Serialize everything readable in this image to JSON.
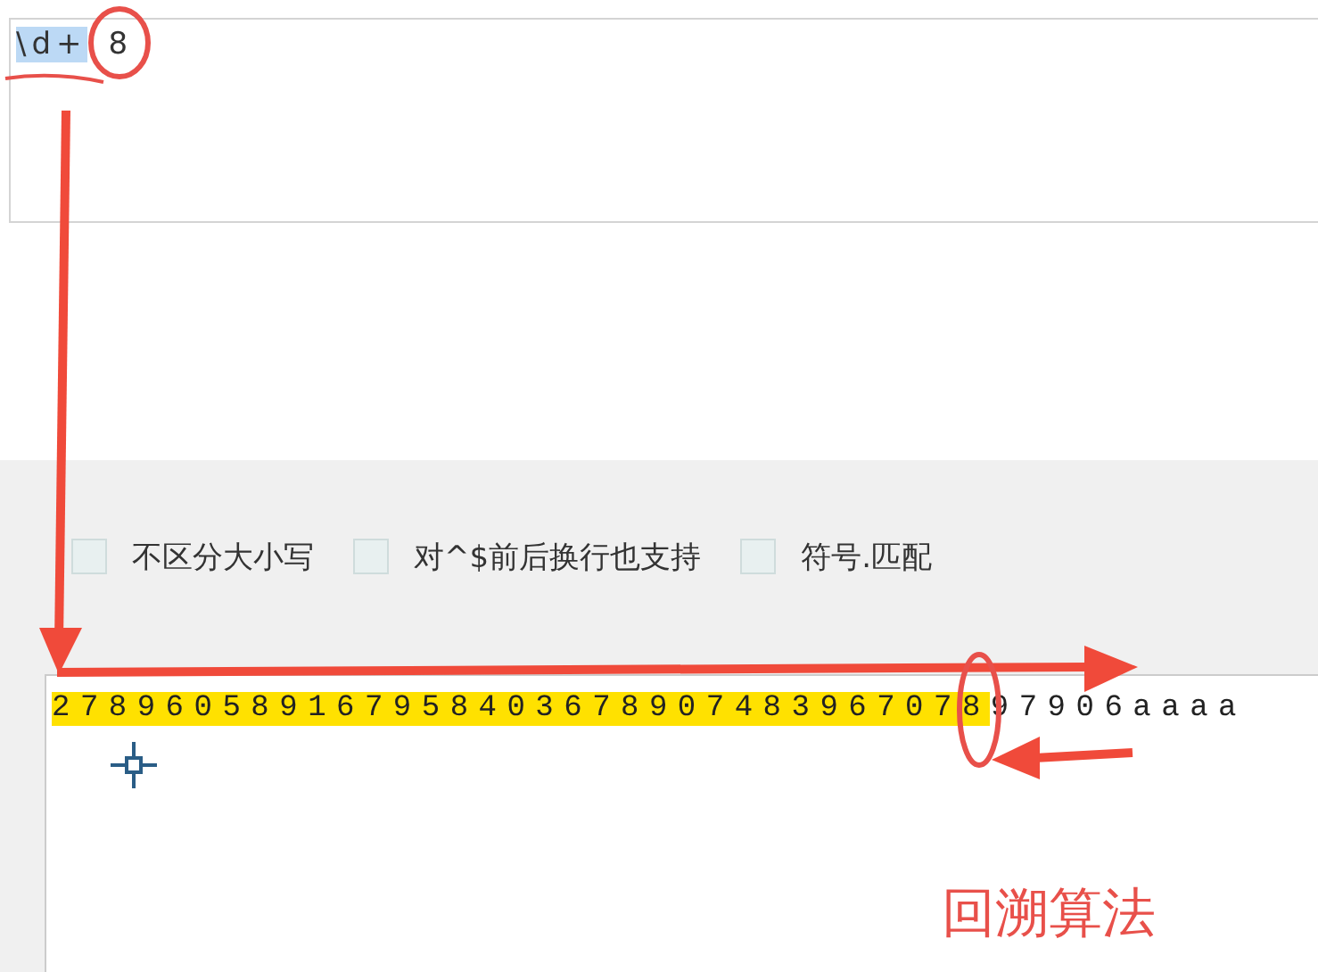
{
  "pattern": {
    "selected_part": "\\d+",
    "rest": "8"
  },
  "options": [
    {
      "label": "不区分大小写",
      "checked": false
    },
    {
      "label": "对^$前后换行也支持",
      "checked": false
    },
    {
      "label": "符号.匹配",
      "checked": false
    }
  ],
  "test_text": {
    "matched": "278960589167958403678907483967078",
    "rest": "97906aaaa"
  },
  "annotation": "回溯算法"
}
